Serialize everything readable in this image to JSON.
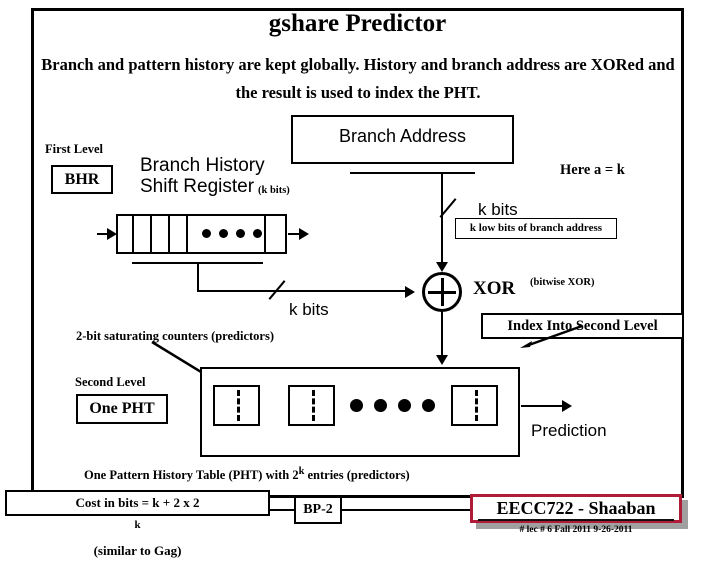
{
  "slide": {
    "title": "gshare Predictor",
    "subtitle": "Branch and pattern history are kept globally. History and branch address are XORed and the result is used to index the PHT."
  },
  "first_level": {
    "label": "First Level",
    "bhr_label": "BHR",
    "shift_register_line1": "Branch History",
    "shift_register_line2": "Shift Register",
    "shift_register_bits": "(k bits)",
    "bus_label": "k bits"
  },
  "branch_address": {
    "box_label": "Branch Address",
    "bus_label": "k bits",
    "note_box": "k low bits of branch address",
    "here_note": "Here a = k"
  },
  "xor": {
    "label": "XOR",
    "note": "(bitwise XOR)",
    "index_label": "Index Into Second Level",
    "symbol": "plus-circle-icon"
  },
  "second_level": {
    "counters_label": "2-bit saturating counters (predictors)",
    "level_label": "Second Level",
    "pht_label": "One PHT",
    "caption": "One Pattern History Table (PHT) with 2^k entries (predictors)",
    "caption_base": "One Pattern History Table (PHT) with 2",
    "caption_exp": "k",
    "caption_tail": " entries (predictors)",
    "prediction_label": "Prediction"
  },
  "footer": {
    "cost_base": "Cost in bits = k + 2 x 2",
    "cost_exp": "k",
    "cost_tail": " (similar to Gag)",
    "bp_label": "BP-2",
    "badge": "EECC722 - Shaaban",
    "meta": "#  lec # 6   Fall 2011   9-26-2011",
    "badge_border_color": "#b01c38"
  }
}
